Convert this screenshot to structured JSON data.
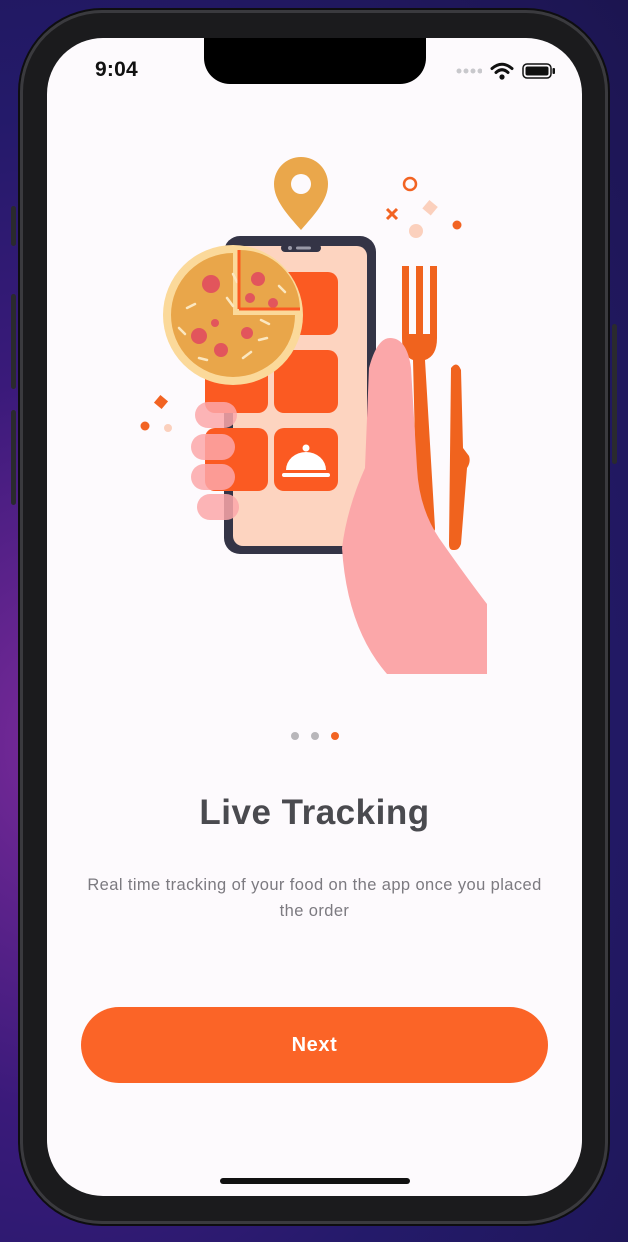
{
  "status_bar": {
    "time": "9:04",
    "icons": [
      "signal-dots-icon",
      "wifi-icon",
      "battery-icon"
    ]
  },
  "onboarding": {
    "illustration": "phone-food-order-illustration",
    "page_indicator": {
      "total": 3,
      "active_index": 2
    },
    "title": "Live Tracking",
    "description": "Real time tracking of your food on the app once you placed the order",
    "next_label": "Next"
  },
  "colors": {
    "accent": "#fb6427",
    "title_text": "#4a4a4f",
    "body_text": "#7c7a80",
    "background": "#fdfafd"
  }
}
